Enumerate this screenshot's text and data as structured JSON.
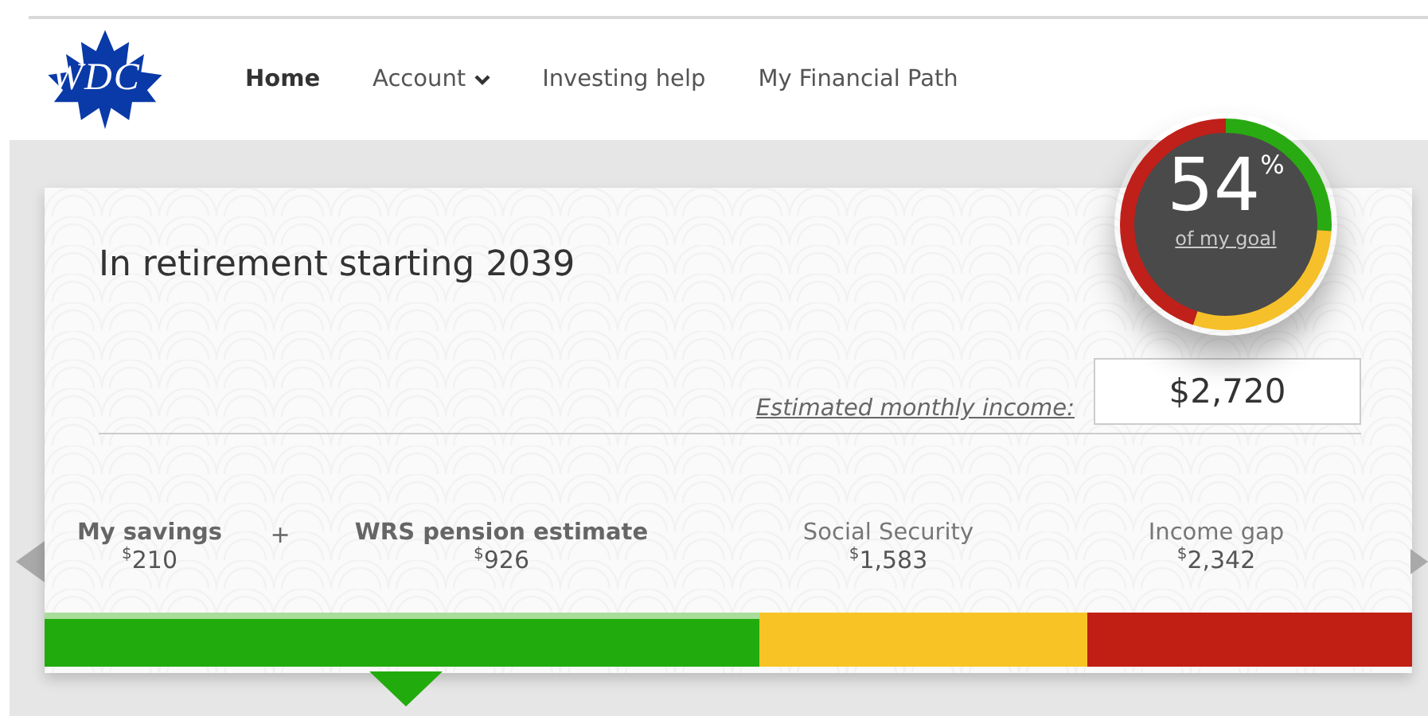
{
  "logo": {
    "text": "WDC"
  },
  "nav": [
    {
      "label": "Home",
      "selected": true,
      "dropdown": false
    },
    {
      "label": "Account",
      "selected": false,
      "dropdown": true
    },
    {
      "label": "Investing help",
      "selected": false,
      "dropdown": false
    },
    {
      "label": "My Financial Path",
      "selected": false,
      "dropdown": false
    }
  ],
  "card": {
    "title": "In retirement starting 2039",
    "income_label": "Estimated monthly income:",
    "income_value": "$2,720"
  },
  "gauge": {
    "value": "54",
    "unit": "%",
    "link": "of my goal",
    "ring": [
      {
        "color": "#2aaa12",
        "level": 0.26
      },
      {
        "color": "#f6c02a",
        "level": 0.29
      },
      {
        "color": "#c0201a",
        "level": 0.45
      }
    ]
  },
  "breakdown": [
    {
      "kind": "item",
      "label": "My savings",
      "currency": "$",
      "amount": "210",
      "strong": true
    },
    {
      "kind": "operator",
      "label": "+"
    },
    {
      "kind": "item",
      "label": "WRS pension estimate",
      "currency": "$",
      "amount": "926",
      "strong": true
    },
    {
      "kind": "item",
      "label": "Social Security",
      "currency": "$",
      "amount": "1,583",
      "strong": false
    },
    {
      "kind": "item",
      "label": "Income gap",
      "currency": "$",
      "amount": "2,342",
      "strong": false
    }
  ],
  "bar": [
    {
      "color": "#22ab0c",
      "highlighted": true
    },
    {
      "color": "#f8c425",
      "highlighted": false
    },
    {
      "color": "#c11f14",
      "highlighted": false
    }
  ]
}
